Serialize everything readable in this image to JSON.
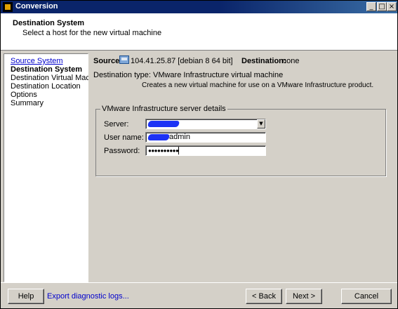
{
  "window": {
    "title": "Conversion",
    "controls": [
      "_",
      "□",
      "×"
    ]
  },
  "header": {
    "title": "Destination System",
    "subtitle": "Select a host for the new virtual machine"
  },
  "sidebar": {
    "items": [
      {
        "label": "Source System",
        "state": "link"
      },
      {
        "label": "Destination System",
        "state": "current"
      },
      {
        "label": "Destination Virtual Machine",
        "state": "normal"
      },
      {
        "label": "Destination Location",
        "state": "normal"
      },
      {
        "label": "Options",
        "state": "normal"
      },
      {
        "label": "Summary",
        "state": "normal"
      }
    ]
  },
  "content": {
    "source_label": "Source:",
    "source_value": "104.41.25.87 [debian 8 64 bit]",
    "destination_label": "Destination:",
    "destination_value": "none",
    "type_label": "Destination type:  VMware Infrastructure virtual machine",
    "type_description": "Creates a new virtual machine for use on a VMware Infrastructure product.",
    "group_title": "VMware Infrastructure server details",
    "server_label": "Server:",
    "username_label": "User name:",
    "username_visible": "admin",
    "password_label": "Password:",
    "password_masked": "●●●●●●●●●●",
    "redaction_color": "#1d33f5"
  },
  "footer": {
    "help": "Help",
    "export_logs": "Export diagnostic logs...",
    "back": "< Back",
    "next": "Next >",
    "cancel": "Cancel"
  }
}
